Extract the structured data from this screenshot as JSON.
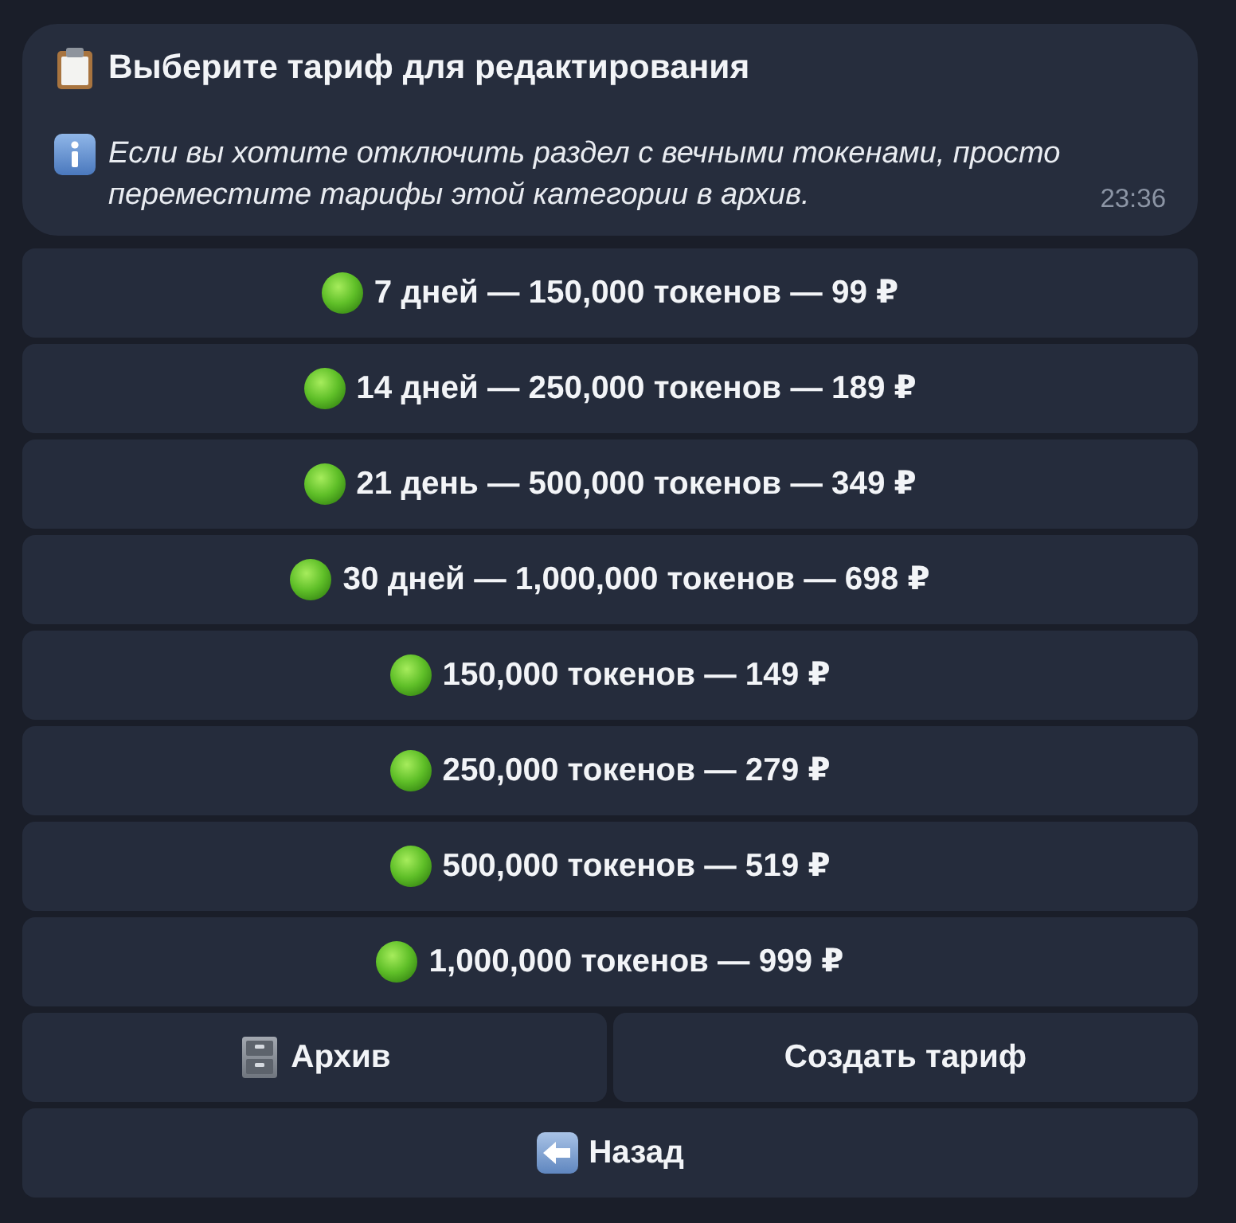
{
  "message": {
    "title": "Выберите тариф для редактирования",
    "note": "Если вы хотите отключить раздел с вечными токенами, просто переместите тарифы этой категории в архив.",
    "time": "23:36"
  },
  "tariff_buttons": [
    {
      "label": "7 дней — 150,000 токенов — 99 ₽"
    },
    {
      "label": "14 дней — 250,000 токенов — 189 ₽"
    },
    {
      "label": "21 день — 500,000 токенов — 349 ₽"
    },
    {
      "label": "30 дней — 1,000,000 токенов — 698 ₽"
    },
    {
      "label": "150,000 токенов — 149 ₽"
    },
    {
      "label": "250,000 токенов — 279 ₽"
    },
    {
      "label": "500,000 токенов — 519 ₽"
    },
    {
      "label": "1,000,000 токенов — 999 ₽"
    }
  ],
  "action_rows": [
    [
      {
        "kind": "archive",
        "label": "Архив"
      },
      {
        "kind": "create",
        "label": "Создать тариф"
      }
    ],
    [
      {
        "kind": "back",
        "label": "Назад"
      }
    ]
  ]
}
